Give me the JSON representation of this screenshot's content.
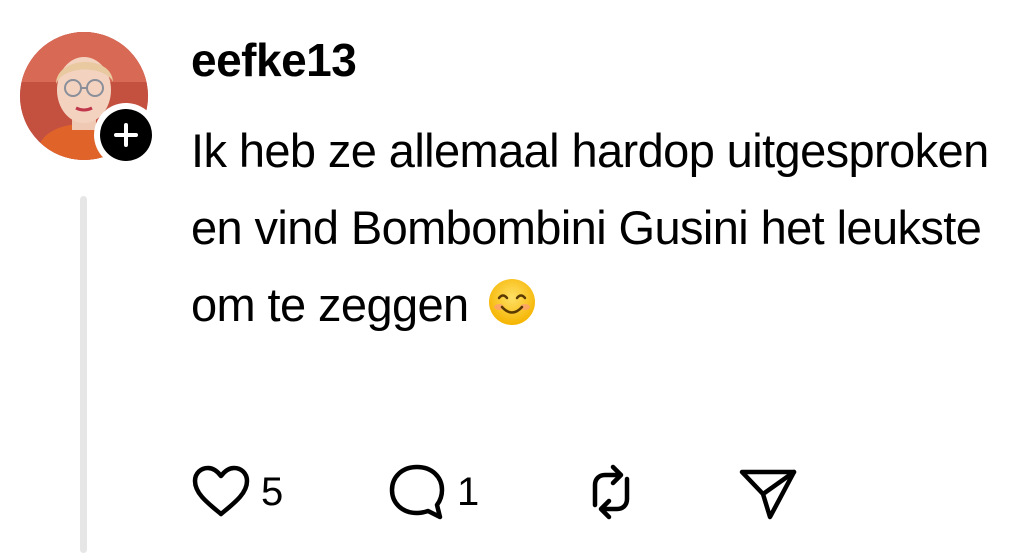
{
  "post": {
    "username": "eefke13",
    "text": "Ik heb ze allemaal hardop uitgesproken en vind Bombombini Gusini het leukste om te zeggen",
    "emoji": "smiling-face-icon"
  },
  "actions": {
    "likes": "5",
    "replies": "1"
  },
  "icons": {
    "like": "heart-icon",
    "reply": "comment-bubble-icon",
    "repost": "repost-icon",
    "share": "send-icon",
    "follow": "plus-icon"
  },
  "colors": {
    "text": "#000000",
    "thread_line": "#e6e6e6",
    "avatar_bg": "#b8463a"
  }
}
